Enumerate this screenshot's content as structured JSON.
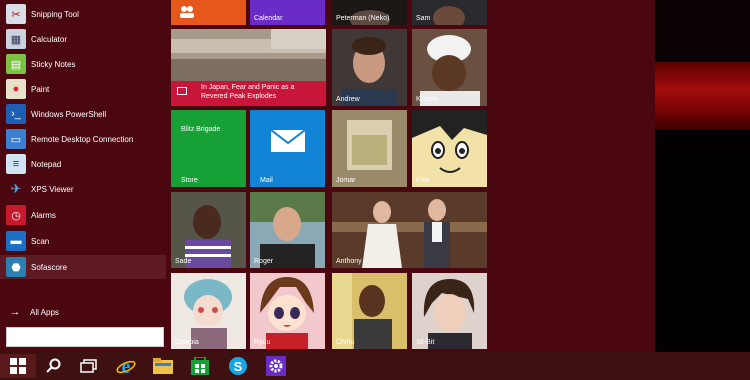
{
  "start_menu": {
    "apps": [
      {
        "label": "Snipping Tool",
        "icon": "scissors-icon"
      },
      {
        "label": "Calculator",
        "icon": "calculator-icon"
      },
      {
        "label": "Sticky Notes",
        "icon": "sticky-note-icon"
      },
      {
        "label": "Paint",
        "icon": "palette-icon"
      },
      {
        "label": "Windows PowerShell",
        "icon": "terminal-icon"
      },
      {
        "label": "Remote Desktop Connection",
        "icon": "remote-desktop-icon"
      },
      {
        "label": "Notepad",
        "icon": "notepad-icon"
      },
      {
        "label": "XPS Viewer",
        "icon": "plane-icon"
      },
      {
        "label": "Alarms",
        "icon": "alarm-clock-icon"
      },
      {
        "label": "Scan",
        "icon": "scanner-icon"
      },
      {
        "label": "Sofascore",
        "icon": "sofascore-icon"
      }
    ],
    "selected_app": "Sofascore",
    "all_apps_label": "All Apps",
    "search": {
      "value": "",
      "placeholder": ""
    }
  },
  "tiles": {
    "people": {
      "label": "",
      "icon": "people-icon"
    },
    "calendar": {
      "label": "Calendar"
    },
    "news": {
      "headline": "In Japan, Fear and Panic as a Revered Peak Explodes",
      "icon": "news-icon"
    },
    "store": {
      "top_text": "Blitz Brigade",
      "label": "Store"
    },
    "mail": {
      "label": "Mail",
      "icon": "envelope-icon"
    },
    "contacts": [
      {
        "label": "Peterman (Neko)"
      },
      {
        "label": "Sam"
      },
      {
        "label": "Andrew"
      },
      {
        "label": "Kristen"
      },
      {
        "label": "Jomar"
      },
      {
        "label": "Kiss"
      },
      {
        "label": "Sade"
      },
      {
        "label": "Roger"
      },
      {
        "label": "Anthony"
      },
      {
        "label": "Celebia"
      },
      {
        "label": "Ryuu"
      },
      {
        "label": "Chihu"
      },
      {
        "label": "16-Bit"
      }
    ]
  },
  "taskbar": {
    "buttons": [
      {
        "icon": "windows-logo-icon"
      },
      {
        "icon": "search-icon"
      },
      {
        "icon": "task-view-icon"
      },
      {
        "icon": "internet-explorer-icon"
      },
      {
        "icon": "file-explorer-icon"
      },
      {
        "icon": "store-icon"
      },
      {
        "icon": "skype-icon"
      },
      {
        "icon": "settings-gear-icon"
      }
    ]
  },
  "colors": {
    "start_bg": "#4b0710",
    "taskbar_bg": "#3f1011",
    "store_tile": "#16a035",
    "mail_tile": "#1184d6",
    "calendar_tile": "#6a2bc7",
    "people_tile": "#e6571b",
    "news_strip": "#c8163a"
  }
}
